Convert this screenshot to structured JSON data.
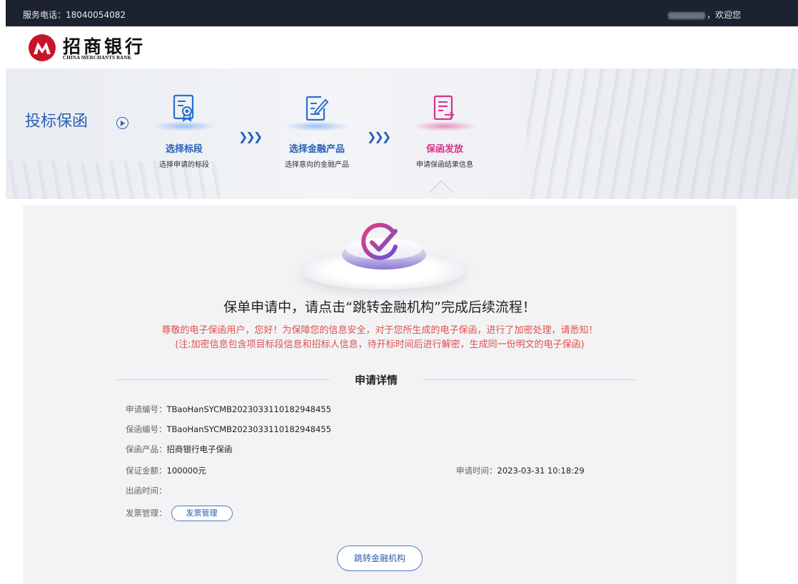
{
  "topbar": {
    "phone_text": "服务电话：18040054082",
    "welcome_suffix": "，欢迎您"
  },
  "logo": {
    "cn": "招商银行",
    "en": "CHINA MERCHANTS BANK",
    "brand_color": "#c8142a"
  },
  "banner": {
    "title": "投标保函",
    "steps": [
      {
        "name": "选择标段",
        "desc": "选择申请的标段",
        "color": "#2a5fb5",
        "icon": "certificate-icon"
      },
      {
        "name": "选择金融产品",
        "desc": "选择意向的金融产品",
        "color": "#2a5fb5",
        "icon": "edit-document-icon"
      },
      {
        "name": "保函发放",
        "desc": "申请保函结果信息",
        "color": "#d6338a",
        "icon": "document-export-icon"
      }
    ],
    "arrows": "❯❯❯"
  },
  "result": {
    "headline": "保单申请中，请点击“跳转金融机构”完成后续流程！",
    "notice_line1": "尊敬的电子保函用户，您好！为保障您的信息安全，对于您所生成的电子保函，进行了加密处理，请悉知！",
    "notice_line2": "(注:加密信息包含项目标段信息和招标人信息，待开标时间后进行解密，生成同一份明文的电子保函)",
    "notice_color": "#e0504f"
  },
  "details": {
    "section_title": "申请详情",
    "application_no_label": "申请编号：",
    "application_no": "TBaoHanSYCMB2023033110182948455",
    "guarantee_no_label": "保函编号：",
    "guarantee_no": "TBaoHanSYCMB2023033110182948455",
    "product_label": "保函产品：",
    "product": "招商银行电子保函",
    "amount_label": "保证金额：",
    "amount": "100000元",
    "apply_time_label": "申请时间：",
    "apply_time": "2023-03-31 10:18:29",
    "issue_time_label": "出函时间：",
    "issue_time": "",
    "invoice_label": "发票管理：",
    "invoice_button": "发票管理"
  },
  "actions": {
    "jump_button": "跳转金融机构"
  }
}
